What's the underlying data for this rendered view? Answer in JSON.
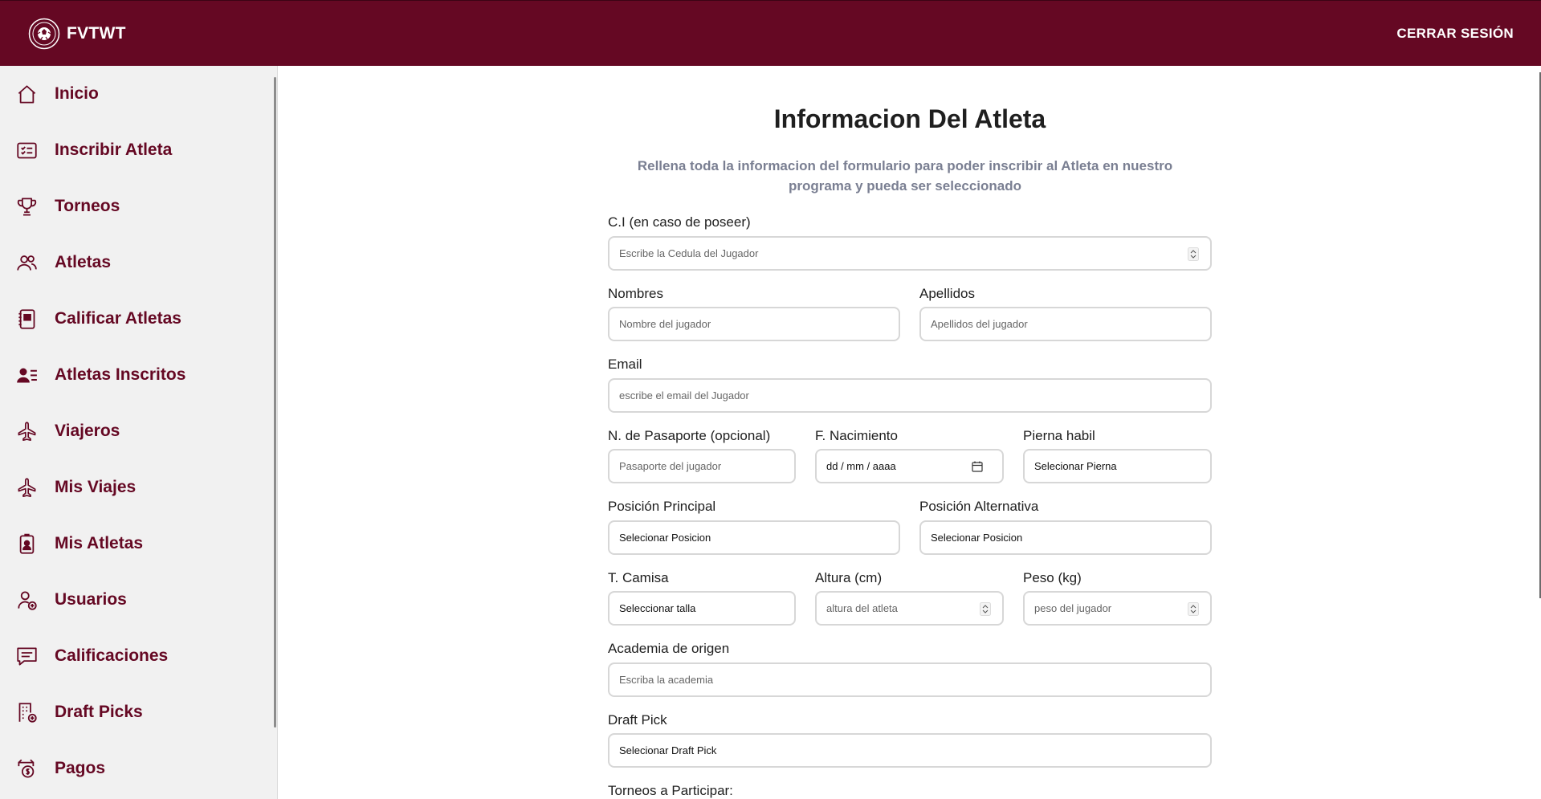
{
  "header": {
    "brand": "FVTWT",
    "logout_label": "CERRAR SESIÓN"
  },
  "colors": {
    "brand": "#650823",
    "muted_text": "#7a7f92",
    "sidebar_bg": "#f1f1f1"
  },
  "sidebar": {
    "items": [
      {
        "label": "Inicio",
        "icon": "home-icon"
      },
      {
        "label": "Inscribir Atleta",
        "icon": "checklist-card-icon"
      },
      {
        "label": "Torneos",
        "icon": "trophy-icon"
      },
      {
        "label": "Atletas",
        "icon": "users-icon"
      },
      {
        "label": "Calificar Atletas",
        "icon": "notebook-icon"
      },
      {
        "label": "Atletas Inscritos",
        "icon": "user-list-icon"
      },
      {
        "label": "Viajeros",
        "icon": "airplane-icon"
      },
      {
        "label": "Mis Viajes",
        "icon": "airplane-icon"
      },
      {
        "label": "Mis Atletas",
        "icon": "id-badge-icon"
      },
      {
        "label": "Usuarios",
        "icon": "user-add-icon"
      },
      {
        "label": "Calificaciones",
        "icon": "message-icon"
      },
      {
        "label": "Draft Picks",
        "icon": "building-add-icon"
      },
      {
        "label": "Pagos",
        "icon": "money-icon"
      }
    ]
  },
  "form": {
    "title": "Informacion Del Atleta",
    "subtitle": "Rellena toda la informacion del formulario para poder inscribir al Atleta en nuestro programa y pueda ser seleccionado",
    "ci": {
      "label": "C.I (en caso de poseer)",
      "placeholder": "Escribe la Cedula del Jugador"
    },
    "nombres": {
      "label": "Nombres",
      "placeholder": "Nombre del jugador"
    },
    "apellidos": {
      "label": "Apellidos",
      "placeholder": "Apellidos del jugador"
    },
    "email": {
      "label": "Email",
      "placeholder": "escribe el email del Jugador"
    },
    "pasaporte": {
      "label": "N. de Pasaporte (opcional)",
      "placeholder": "Pasaporte del jugador"
    },
    "nacimiento": {
      "label": "F. Nacimiento",
      "value": "dd / mm / aaaa"
    },
    "pierna": {
      "label": "Pierna habil",
      "value": "Selecionar Pierna"
    },
    "posicion_principal": {
      "label": "Posición Principal",
      "value": "Selecionar Posicion"
    },
    "posicion_alternativa": {
      "label": "Posición Alternativa",
      "value": "Selecionar Posicion"
    },
    "camisa": {
      "label": "T. Camisa",
      "value": "Seleccionar talla"
    },
    "altura": {
      "label": "Altura (cm)",
      "placeholder": "altura del atleta"
    },
    "peso": {
      "label": "Peso (kg)",
      "placeholder": "peso del jugador"
    },
    "academia": {
      "label": "Academia de origen",
      "placeholder": "Escriba la academia"
    },
    "draft": {
      "label": "Draft Pick",
      "value": "Selecionar Draft Pick"
    },
    "torneos": {
      "label": "Torneos a Participar:"
    }
  }
}
